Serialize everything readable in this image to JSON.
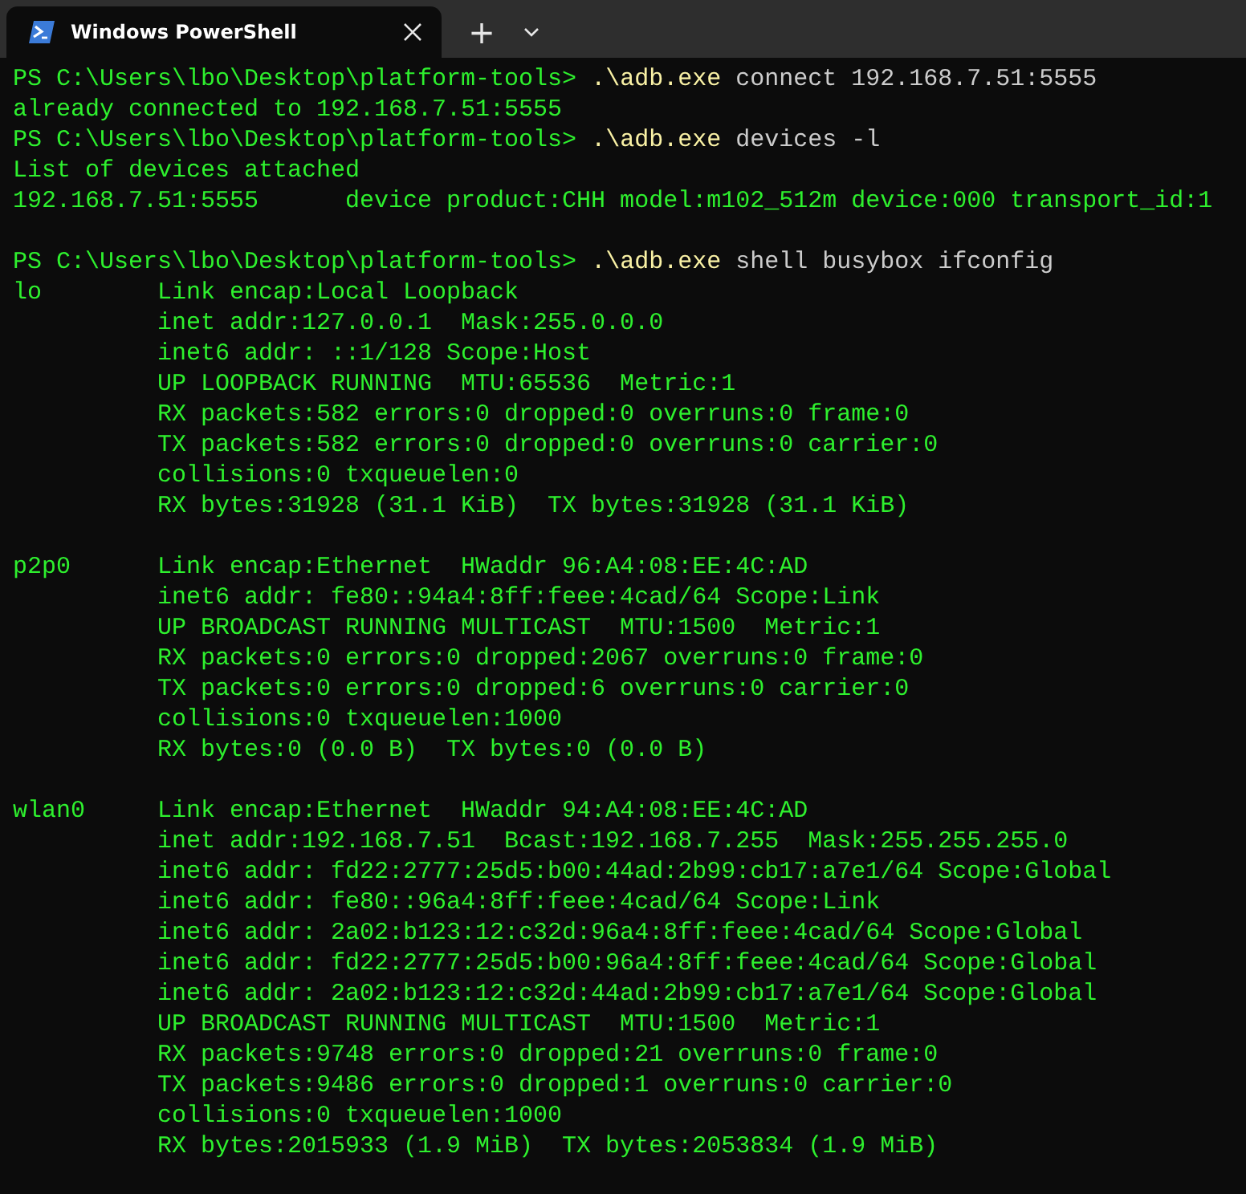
{
  "tabs": [
    {
      "title": "Windows PowerShell",
      "selected": true
    }
  ],
  "tab_bar": {
    "new_tab": "+"
  },
  "lines": [
    {
      "kind": "command",
      "prompt": "PS C:\\Users\\lbo\\Desktop\\platform-tools>",
      "program": ".\\adb.exe",
      "args": "connect 192.168.7.51:5555"
    },
    {
      "kind": "output",
      "text": "already connected to 192.168.7.51:5555"
    },
    {
      "kind": "command",
      "prompt": "PS C:\\Users\\lbo\\Desktop\\platform-tools>",
      "program": ".\\adb.exe",
      "args": "devices -l"
    },
    {
      "kind": "output",
      "text": "List of devices attached"
    },
    {
      "kind": "output",
      "text": "192.168.7.51:5555      device product:CHH model:m102_512m device:000 transport_id:1"
    },
    {
      "kind": "blank"
    },
    {
      "kind": "command",
      "prompt": "PS C:\\Users\\lbo\\Desktop\\platform-tools>",
      "program": ".\\adb.exe",
      "args": "shell busybox ifconfig"
    },
    {
      "kind": "output",
      "text": "lo        Link encap:Local Loopback"
    },
    {
      "kind": "output",
      "text": "          inet addr:127.0.0.1  Mask:255.0.0.0"
    },
    {
      "kind": "output",
      "text": "          inet6 addr: ::1/128 Scope:Host"
    },
    {
      "kind": "output",
      "text": "          UP LOOPBACK RUNNING  MTU:65536  Metric:1"
    },
    {
      "kind": "output",
      "text": "          RX packets:582 errors:0 dropped:0 overruns:0 frame:0"
    },
    {
      "kind": "output",
      "text": "          TX packets:582 errors:0 dropped:0 overruns:0 carrier:0"
    },
    {
      "kind": "output",
      "text": "          collisions:0 txqueuelen:0"
    },
    {
      "kind": "output",
      "text": "          RX bytes:31928 (31.1 KiB)  TX bytes:31928 (31.1 KiB)"
    },
    {
      "kind": "blank"
    },
    {
      "kind": "output",
      "text": "p2p0      Link encap:Ethernet  HWaddr 96:A4:08:EE:4C:AD"
    },
    {
      "kind": "output",
      "text": "          inet6 addr: fe80::94a4:8ff:feee:4cad/64 Scope:Link"
    },
    {
      "kind": "output",
      "text": "          UP BROADCAST RUNNING MULTICAST  MTU:1500  Metric:1"
    },
    {
      "kind": "output",
      "text": "          RX packets:0 errors:0 dropped:2067 overruns:0 frame:0"
    },
    {
      "kind": "output",
      "text": "          TX packets:0 errors:0 dropped:6 overruns:0 carrier:0"
    },
    {
      "kind": "output",
      "text": "          collisions:0 txqueuelen:1000"
    },
    {
      "kind": "output",
      "text": "          RX bytes:0 (0.0 B)  TX bytes:0 (0.0 B)"
    },
    {
      "kind": "blank"
    },
    {
      "kind": "output",
      "text": "wlan0     Link encap:Ethernet  HWaddr 94:A4:08:EE:4C:AD"
    },
    {
      "kind": "output",
      "text": "          inet addr:192.168.7.51  Bcast:192.168.7.255  Mask:255.255.255.0"
    },
    {
      "kind": "output",
      "text": "          inet6 addr: fd22:2777:25d5:b00:44ad:2b99:cb17:a7e1/64 Scope:Global"
    },
    {
      "kind": "output",
      "text": "          inet6 addr: fe80::96a4:8ff:feee:4cad/64 Scope:Link"
    },
    {
      "kind": "output",
      "text": "          inet6 addr: 2a02:b123:12:c32d:96a4:8ff:feee:4cad/64 Scope:Global"
    },
    {
      "kind": "output",
      "text": "          inet6 addr: fd22:2777:25d5:b00:96a4:8ff:feee:4cad/64 Scope:Global"
    },
    {
      "kind": "output",
      "text": "          inet6 addr: 2a02:b123:12:c32d:44ad:2b99:cb17:a7e1/64 Scope:Global"
    },
    {
      "kind": "output",
      "text": "          UP BROADCAST RUNNING MULTICAST  MTU:1500  Metric:1"
    },
    {
      "kind": "output",
      "text": "          RX packets:9748 errors:0 dropped:21 overruns:0 frame:0"
    },
    {
      "kind": "output",
      "text": "          TX packets:9486 errors:0 dropped:1 overruns:0 carrier:0"
    },
    {
      "kind": "output",
      "text": "          collisions:0 txqueuelen:1000"
    },
    {
      "kind": "output",
      "text": "          RX bytes:2015933 (1.9 MiB)  TX bytes:2053834 (1.9 MiB)"
    }
  ]
}
